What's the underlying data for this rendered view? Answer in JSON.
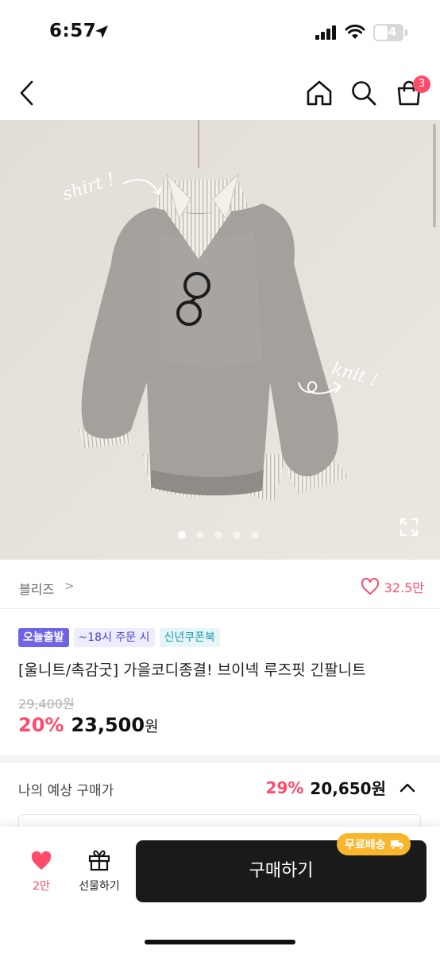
{
  "status_bar": {
    "time": "6:57",
    "battery": "44"
  },
  "header": {
    "icons": [
      "back-icon",
      "home-icon",
      "search-icon",
      "cart-icon"
    ],
    "cart_count": "3"
  },
  "gallery": {
    "handwriting_left": "shirt !",
    "handwriting_right": "knit !",
    "slide_count": 5,
    "active_slide": 1
  },
  "category": {
    "label": "블리즈",
    "arrow": ">",
    "like_count": "32.5만"
  },
  "badges": {
    "today": "오늘출발",
    "deadline": "~18시 주문 시",
    "coupon": "신년쿠폰북"
  },
  "product": {
    "title": "[울니트/촉감굿] 가을코디종결! 브이넥 루즈핏 긴팔니트",
    "original_price": "29,400원",
    "discount": "20%",
    "price": "23,500",
    "price_unit": "원"
  },
  "expected": {
    "label": "나의 예상 구매가",
    "discount": "29%",
    "price": "20,650원"
  },
  "bottom_bar": {
    "wish_label": "2만",
    "gift_label": "선물하기",
    "buy_label": "구매하기",
    "shipping_tag": "무료배송"
  },
  "colors": {
    "accent": "#ff4b6b",
    "today_badge": "#6f63e6",
    "buy_button": "#1a1a1a",
    "shipping_tag": "#f9b62c"
  }
}
